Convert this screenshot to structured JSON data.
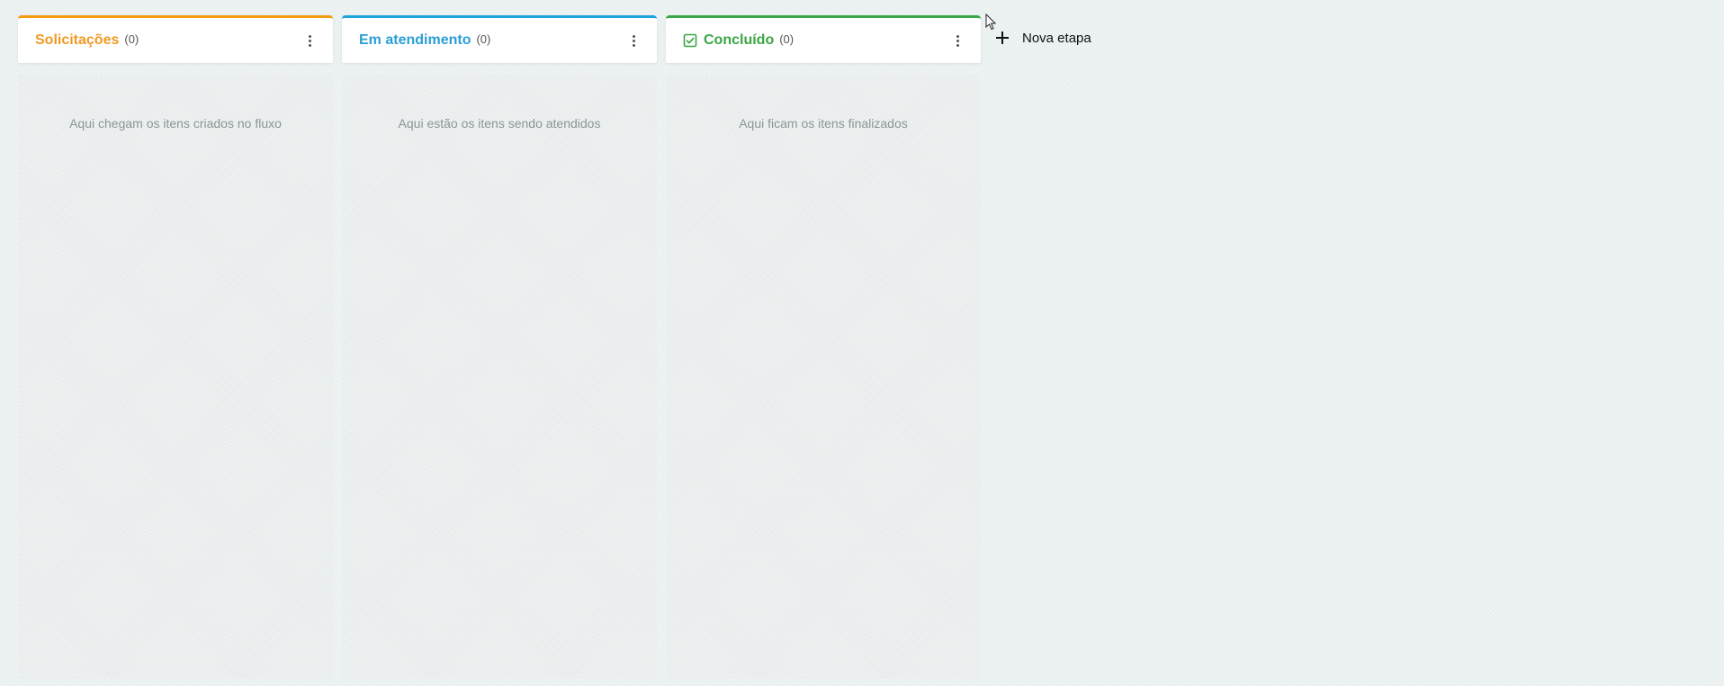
{
  "columns": [
    {
      "title": "Solicitações",
      "count": "(0)",
      "accent": "#f39c12",
      "empty_message": "Aqui chegam os itens criados no fluxo"
    },
    {
      "title": "Em atendimento",
      "count": "(0)",
      "accent": "#1ea3dc",
      "empty_message": "Aqui estão os itens sendo atendidos"
    },
    {
      "title": "Concluído",
      "count": "(0)",
      "accent": "#3aa645",
      "icon": "check-square-icon",
      "empty_message": "Aqui ficam os itens finalizados"
    }
  ],
  "new_stage": {
    "label": "Nova etapa",
    "icon": "plus-icon"
  }
}
